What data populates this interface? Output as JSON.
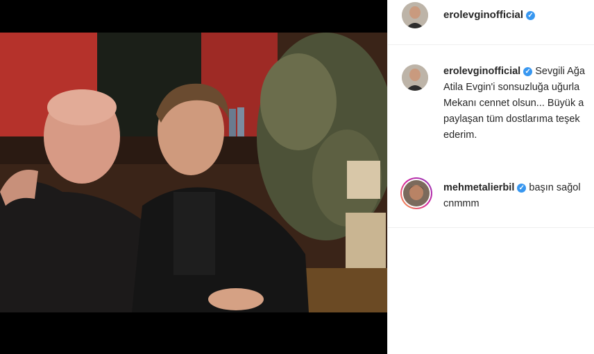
{
  "post": {
    "photo_alt": "photo",
    "header": {
      "username": "erolevginofficial",
      "verified": true
    },
    "caption": {
      "username": "erolevginofficial",
      "verified": true,
      "lines": [
        "Sevgili Ağa",
        "Atila Evgin'i sonsuzluğa uğurla",
        "Mekanı cennet olsun... Büyük a",
        "paylaşan tüm dostlarıma teşek",
        "ederim."
      ]
    },
    "comments": [
      {
        "username": "mehmetalierbil",
        "verified": true,
        "text_first": "başın sağol",
        "text_rest": "cnmmm"
      }
    ]
  },
  "colors": {
    "verified_badge": "#3897f0",
    "divider": "#efefef",
    "username": "#262626"
  },
  "icons": {
    "verified": "check-badge-icon"
  }
}
